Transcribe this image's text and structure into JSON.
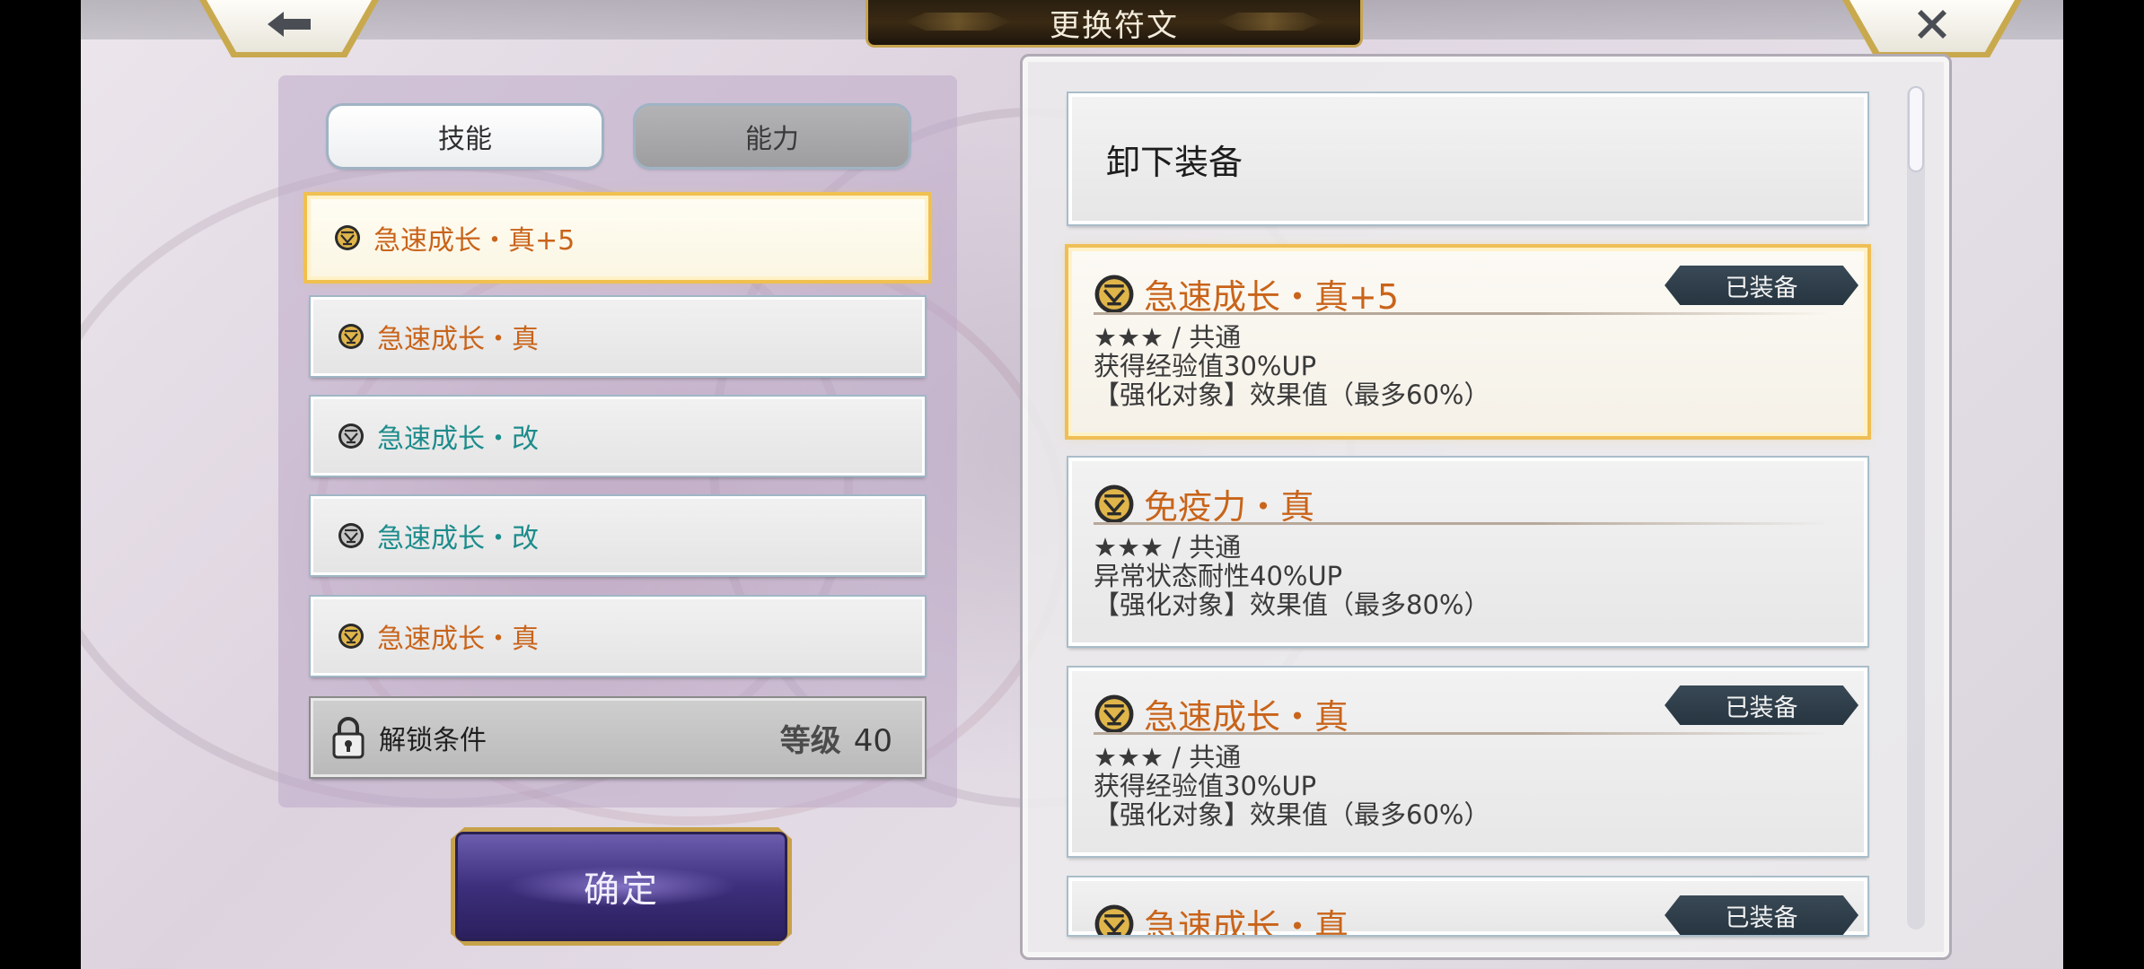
{
  "header": {
    "title": "更换符文",
    "back_icon": "arrow-left-icon",
    "close_icon": "close-icon"
  },
  "tabs": [
    {
      "label": "技能",
      "active": true
    },
    {
      "label": "能力",
      "active": false
    }
  ],
  "slots": [
    {
      "name": "急速成长・真+5",
      "color": "#c9641a",
      "selected": true
    },
    {
      "name": "急速成长・真",
      "color": "#c9641a",
      "selected": false
    },
    {
      "name": "急速成长・改",
      "color": "#1d8c8c",
      "selected": false
    },
    {
      "name": "急速成长・改",
      "color": "#1d8c8c",
      "selected": false
    },
    {
      "name": "急速成长・真",
      "color": "#c9641a",
      "selected": false
    }
  ],
  "lock": {
    "label": "解锁条件",
    "level_label": "等级",
    "level_value": "40",
    "icon": "lock-icon"
  },
  "confirm_label": "确定",
  "unequip_label": "卸下装备",
  "runes": [
    {
      "name": "急速成长・真+5",
      "badge": "已装备",
      "rarity": "★★★ / 共通",
      "effect": "获得经验值30%UP",
      "enhance": "【强化对象】效果值（最多60%）",
      "selected": true
    },
    {
      "name": "免疫力・真",
      "badge": "",
      "rarity": "★★★ / 共通",
      "effect": "异常状态耐性40%UP",
      "enhance": "【强化对象】效果值（最多80%）",
      "selected": false
    },
    {
      "name": "急速成长・真",
      "badge": "已装备",
      "rarity": "★★★ / 共通",
      "effect": "获得经验值30%UP",
      "enhance": "【强化对象】效果值（最多60%）",
      "selected": false
    },
    {
      "name": "急速成长・真",
      "badge": "已装备",
      "rarity": "",
      "effect": "",
      "enhance": "",
      "selected": false
    }
  ],
  "colors": {
    "accent_orange": "#c9641a",
    "accent_teal": "#1d8c8c",
    "gold_frame": "#efbf55",
    "badge_bg": "#2f3f4a"
  }
}
